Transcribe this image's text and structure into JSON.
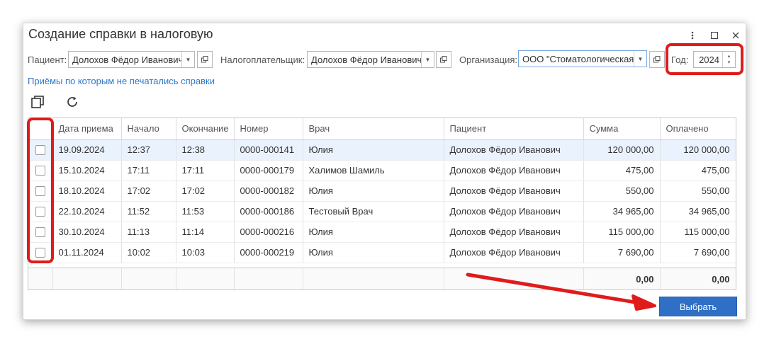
{
  "window": {
    "title": "Создание справки в налоговую"
  },
  "filters": {
    "patient_label": "Пациент:",
    "patient_value": "Долохов Фёдор Иванович",
    "payer_label": "Налогоплательщик:",
    "payer_value": "Долохов Фёдор Иванович",
    "org_label": "Организация:",
    "org_value": "ООО \"Стоматологическая",
    "year_label": "Год:",
    "year_value": "2024"
  },
  "link_text": "Приёмы по которым не печатались справки",
  "table": {
    "columns": [
      "Дата приема",
      "Начало",
      "Окончание",
      "Номер",
      "Врач",
      "Пациент",
      "Сумма",
      "Оплачено"
    ],
    "rows": [
      {
        "date": "19.09.2024",
        "start": "12:37",
        "end": "12:38",
        "number": "0000-000141",
        "doctor": "Юлия",
        "patient": "Долохов Фёдор Иванович",
        "sum": "120 000,00",
        "paid": "120 000,00"
      },
      {
        "date": "15.10.2024",
        "start": "17:11",
        "end": "17:11",
        "number": "0000-000179",
        "doctor": "Халимов Шамиль",
        "patient": "Долохов Фёдор Иванович",
        "sum": "475,00",
        "paid": "475,00"
      },
      {
        "date": "18.10.2024",
        "start": "17:02",
        "end": "17:02",
        "number": "0000-000182",
        "doctor": "Юлия",
        "patient": "Долохов Фёдор Иванович",
        "sum": "550,00",
        "paid": "550,00"
      },
      {
        "date": "22.10.2024",
        "start": "11:52",
        "end": "11:53",
        "number": "0000-000186",
        "doctor": "Тестовый Врач",
        "patient": "Долохов Фёдор Иванович",
        "sum": "34 965,00",
        "paid": "34 965,00"
      },
      {
        "date": "30.10.2024",
        "start": "11:13",
        "end": "11:14",
        "number": "0000-000216",
        "doctor": "Юлия",
        "patient": "Долохов Фёдор Иванович",
        "sum": "115 000,00",
        "paid": "115 000,00"
      },
      {
        "date": "01.11.2024",
        "start": "10:02",
        "end": "10:03",
        "number": "0000-000219",
        "doctor": "Юлия",
        "patient": "Долохов Фёдор Иванович",
        "sum": "7 690,00",
        "paid": "7 690,00"
      }
    ],
    "total_sum": "0,00",
    "total_paid": "0,00"
  },
  "buttons": {
    "select_label": "Выбрать"
  },
  "icons": {
    "more": "more-vertical-icon",
    "maximize": "maximize-icon",
    "close": "close-icon",
    "copy": "copy-icon",
    "refresh": "refresh-icon",
    "open": "open-external-icon"
  },
  "colors": {
    "accent": "#2f6fc6",
    "link": "#2d78c8",
    "highlight": "#e01b1b",
    "selected_row": "#eaf2fd"
  }
}
